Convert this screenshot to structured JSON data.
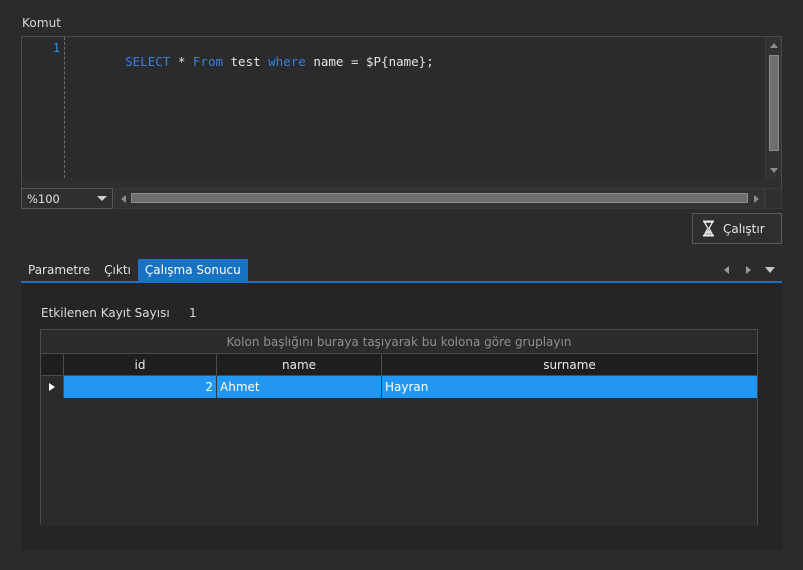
{
  "command_section": {
    "label": "Komut",
    "line_number": "1",
    "sql_tokens": [
      {
        "text": "SELECT",
        "type": "keyword"
      },
      {
        "text": " * ",
        "type": "plain"
      },
      {
        "text": "From",
        "type": "keyword"
      },
      {
        "text": " test ",
        "type": "plain"
      },
      {
        "text": "where",
        "type": "keyword"
      },
      {
        "text": " name = $P{name};",
        "type": "plain"
      }
    ],
    "sql_full": "SELECT * From test where name = $P{name};",
    "zoom_value": "%100",
    "zoom_chevron_icon": "chevron-down-icon",
    "scroll_up_icon": "triangle-up-icon",
    "scroll_down_icon": "triangle-down-icon",
    "scroll_left_icon": "triangle-left-icon",
    "scroll_right_icon": "triangle-right-icon"
  },
  "run_button": {
    "label": "Çalıştır",
    "icon": "hourglass-icon"
  },
  "tabs": {
    "items": [
      {
        "label": "Parametre",
        "active": false
      },
      {
        "label": "Çıktı",
        "active": false
      },
      {
        "label": "Çalışma Sonucu",
        "active": true
      }
    ],
    "nav": {
      "prev_icon": "triangle-left-icon",
      "next_icon": "triangle-right-icon",
      "menu_icon": "triangle-down-icon"
    },
    "active_color": "#1772c4"
  },
  "results": {
    "affected_label": "Etkilenen Kayıt Sayısı",
    "affected_value": "1",
    "group_panel_text": "Kolon başlığını buraya taşıyarak bu kolona göre gruplayın",
    "columns": [
      "id",
      "name",
      "surname"
    ],
    "rows": [
      {
        "indicator_icon": "row-selector-icon",
        "id": "2",
        "name": "Ahmet",
        "surname": "Hayran",
        "selected": true
      }
    ],
    "selection_color": "#2196f3"
  }
}
